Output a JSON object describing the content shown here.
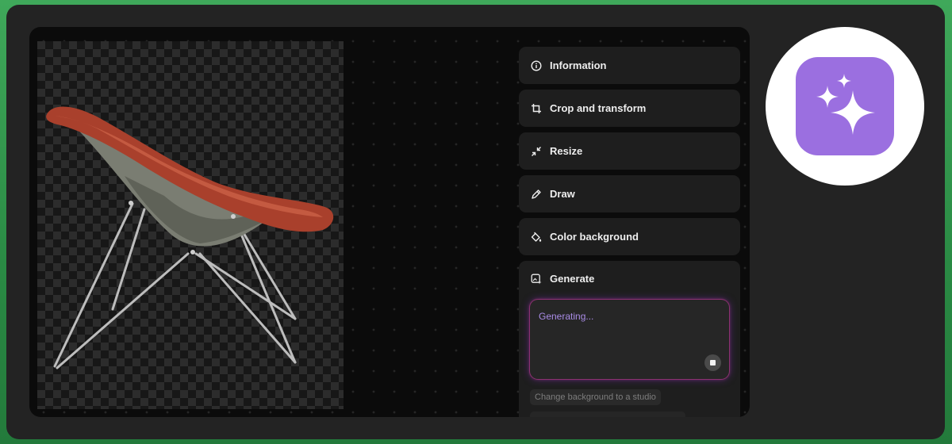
{
  "tools": [
    {
      "label": "Information",
      "icon": "info-icon"
    },
    {
      "label": "Crop and transform",
      "icon": "crop-icon"
    },
    {
      "label": "Resize",
      "icon": "resize-icon"
    },
    {
      "label": "Draw",
      "icon": "draw-icon"
    },
    {
      "label": "Color background",
      "icon": "paint-bucket-icon"
    }
  ],
  "generate": {
    "label": "Generate",
    "icon": "generate-icon",
    "status": "Generating...",
    "suggestion": "Change background to a studio"
  },
  "app_icon": {
    "icon": "sparkles-icon",
    "color": "#9b6fe0"
  },
  "canvas": {
    "subject": "chair-image"
  }
}
